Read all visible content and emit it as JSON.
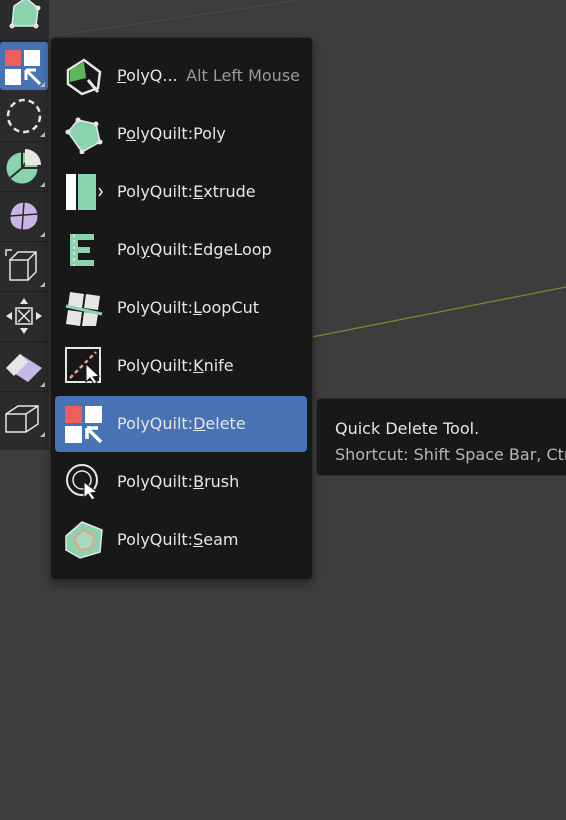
{
  "colors": {
    "viewport_bg": "#3d3d3d",
    "menu_bg": "#181818",
    "highlight": "#4772b3",
    "tool_green": "#8ad4ad",
    "tool_red": "#ef5d5d",
    "grid_line": "#6e8c2e"
  },
  "toolbar": {
    "tools": [
      {
        "icon": "polyquilt-poly-icon"
      },
      {
        "icon": "polyquilt-delete-icon",
        "active": true
      },
      {
        "icon": "select-circle-icon"
      },
      {
        "icon": "pie-menu-icon"
      },
      {
        "icon": "sphere-icon"
      },
      {
        "icon": "cube-extrude-icon"
      },
      {
        "icon": "move-icon"
      },
      {
        "icon": "rhombus-icon"
      },
      {
        "icon": "cube-icon"
      }
    ]
  },
  "menu": {
    "items": [
      {
        "icon": "polyquilt-icon",
        "label_pre": "",
        "label_ul": "P",
        "label_post": "olyQ...",
        "shortcut": "Alt Left Mouse"
      },
      {
        "icon": "polyquilt-poly-icon",
        "label_pre": "P",
        "label_ul": "o",
        "label_post": "lyQuilt:Poly"
      },
      {
        "icon": "polyquilt-extrude-icon",
        "label_pre": "PolyQuilt:",
        "label_ul": "E",
        "label_post": "xtrude"
      },
      {
        "icon": "polyquilt-edgeloop-icon",
        "label_pre": "Pol",
        "label_ul": "y",
        "label_post": "Quilt:EdgeLoop"
      },
      {
        "icon": "polyquilt-loopcut-icon",
        "label_pre": "PolyQuilt:",
        "label_ul": "L",
        "label_post": "oopCut"
      },
      {
        "icon": "polyquilt-knife-icon",
        "label_pre": "PolyQuilt:",
        "label_ul": "K",
        "label_post": "nife"
      },
      {
        "icon": "polyquilt-delete-icon",
        "label_pre": "PolyQuilt:",
        "label_ul": "D",
        "label_post": "elete",
        "active": true
      },
      {
        "icon": "polyquilt-brush-icon",
        "label_pre": "PolyQuilt:",
        "label_ul": "B",
        "label_post": "rush"
      },
      {
        "icon": "polyquilt-seam-icon",
        "label_pre": "PolyQuilt:",
        "label_ul": "S",
        "label_post": "eam"
      }
    ]
  },
  "tooltip": {
    "title": "Quick Delete Tool.",
    "shortcut": "Shortcut: Shift Space Bar, Ctrl"
  }
}
